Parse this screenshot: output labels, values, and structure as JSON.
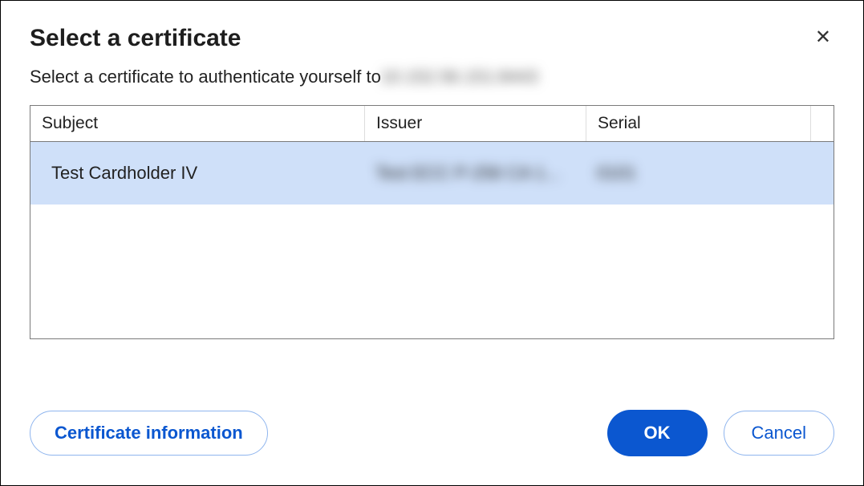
{
  "dialog": {
    "title": "Select a certificate",
    "subtitle_prefix": "Select a certificate to authenticate yourself to ",
    "subtitle_host_redacted": "10.152.56.151:8443"
  },
  "table": {
    "headers": {
      "subject": "Subject",
      "issuer": "Issuer",
      "serial": "Serial"
    },
    "rows": [
      {
        "subject": "Test Cardholder IV",
        "issuer_redacted": "Test ECC P-256 CA 1...",
        "serial_redacted": "0101",
        "selected": true
      }
    ]
  },
  "buttons": {
    "cert_info": "Certificate information",
    "ok": "OK",
    "cancel": "Cancel"
  }
}
